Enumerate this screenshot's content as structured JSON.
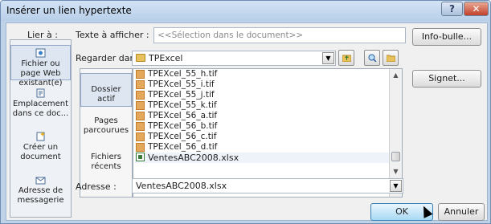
{
  "window": {
    "title": "Insérer un lien hypertexte",
    "help_label": "?",
    "close_label": "✕"
  },
  "link_to": {
    "label": "Lier à :",
    "items": [
      {
        "label": "Fichier ou page Web existant(e)",
        "icon": "web-page-icon",
        "selected": true
      },
      {
        "label": "Emplacement dans ce doc...",
        "icon": "document-place-icon",
        "selected": false
      },
      {
        "label": "Créer un document",
        "icon": "new-document-icon",
        "selected": false
      },
      {
        "label": "Adresse de messagerie",
        "icon": "email-icon",
        "selected": false
      }
    ]
  },
  "text_to_display": {
    "label": "Texte à afficher :",
    "value": "<<Sélection dans le document>>"
  },
  "look_in": {
    "label": "Regarder dans :",
    "value": "TPExcel"
  },
  "side_panel": [
    {
      "label": "Dossier actif",
      "selected": true
    },
    {
      "label": "Pages parcourues",
      "selected": false
    },
    {
      "label": "Fichiers récents",
      "selected": false
    }
  ],
  "files": [
    {
      "name": "TPEXcel_55_h.tif",
      "type": "tif"
    },
    {
      "name": "TPEXcel_55_i.tif",
      "type": "tif"
    },
    {
      "name": "TPEXcel_55_j.tif",
      "type": "tif"
    },
    {
      "name": "TPEXcel_55_k.tif",
      "type": "tif"
    },
    {
      "name": "TPEXcel_56_a.tif",
      "type": "tif"
    },
    {
      "name": "TPEXcel_56_b.tif",
      "type": "tif"
    },
    {
      "name": "TPEXcel_56_c.tif",
      "type": "tif"
    },
    {
      "name": "TPEXcel_56_d.tif",
      "type": "tif"
    },
    {
      "name": "VentesABC2008.xlsx",
      "type": "xlsx"
    }
  ],
  "address": {
    "label": "Adresse :",
    "value": "VentesABC2008.xlsx"
  },
  "buttons": {
    "screentip": "Info-bulle...",
    "bookmark": "Signet...",
    "ok": "OK",
    "cancel": "Annuler"
  }
}
